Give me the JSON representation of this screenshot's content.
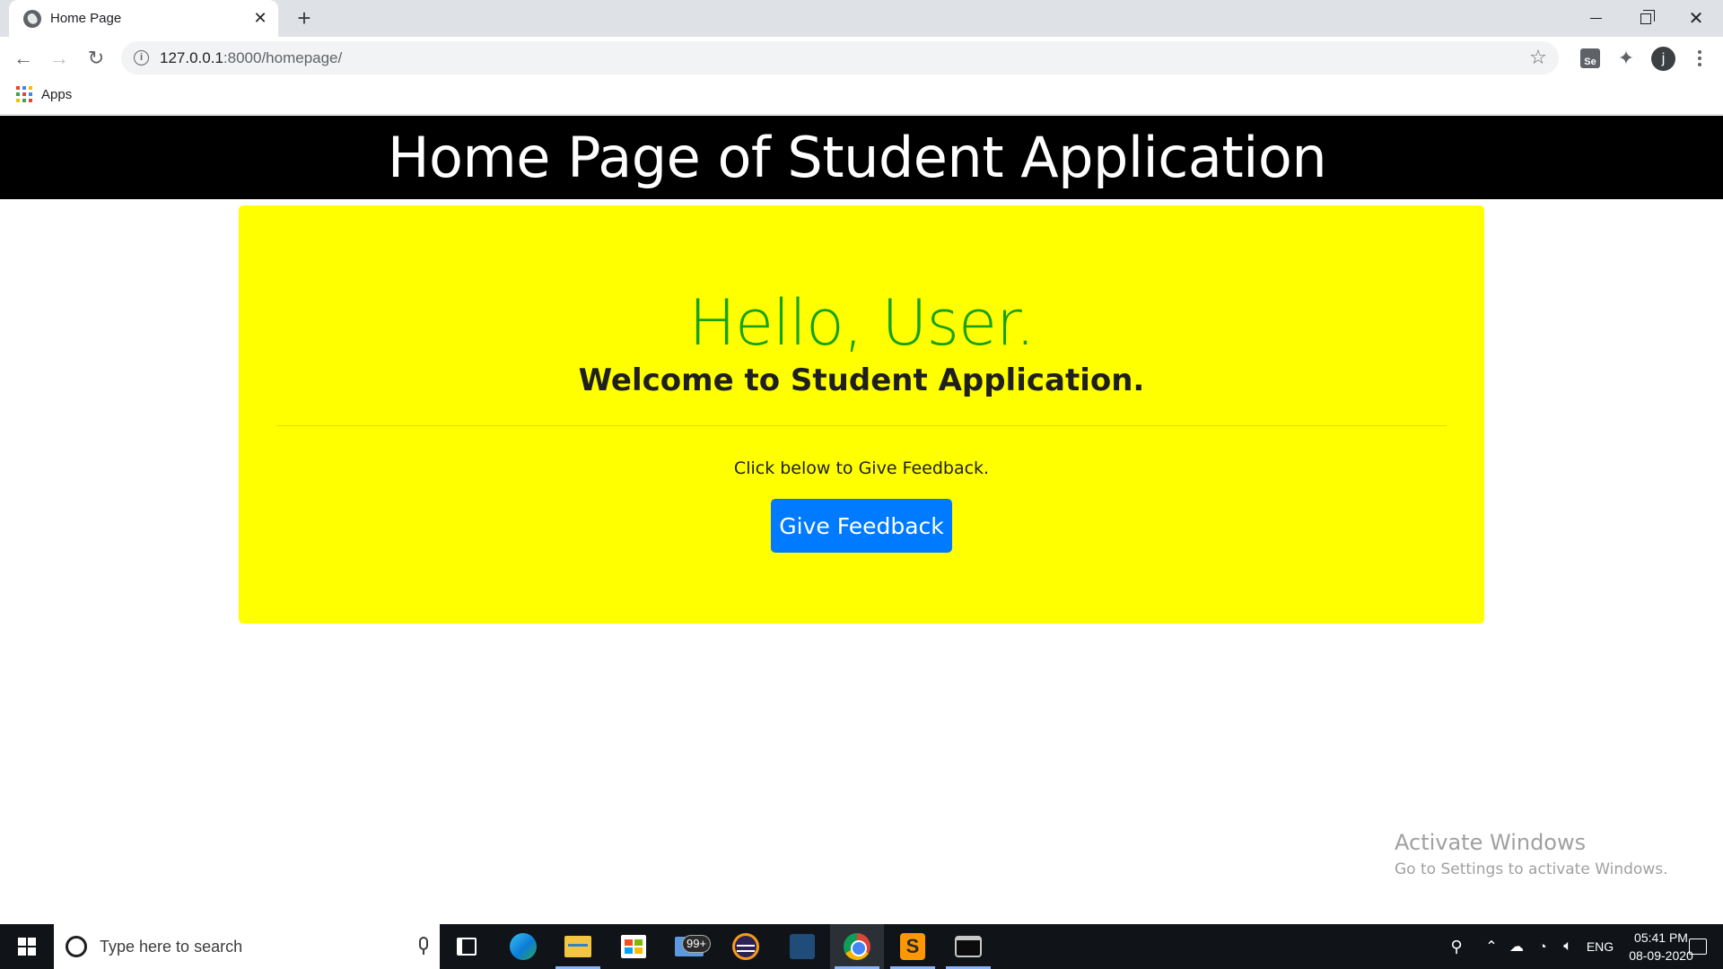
{
  "browser": {
    "tab_title": "Home Page",
    "url_host": "127.0.0.1",
    "url_path": ":8000/homepage/",
    "bookmarks": {
      "apps_label": "Apps"
    },
    "extensions": {
      "se_label": "Se"
    },
    "profile_initial": "j"
  },
  "page": {
    "header_title": "Home Page of Student Application",
    "greeting": "Hello, User.",
    "welcome": "Welcome to Student Application.",
    "hint": "Click below to Give Feedback.",
    "feedback_button": "Give Feedback",
    "colors": {
      "header_bg": "#000000",
      "jumbotron_bg": "#ffff00",
      "greeting": "#15a215",
      "button": "#007bff"
    }
  },
  "watermark": {
    "title": "Activate Windows",
    "subtitle": "Go to Settings to activate Windows."
  },
  "taskbar": {
    "search_placeholder": "Type here to search",
    "mail_badge": "99+",
    "language": "ENG",
    "time": "05:41 PM",
    "date": "08-09-2020",
    "apps": [
      "task-view",
      "edge",
      "file-explorer",
      "store",
      "mail",
      "eclipse",
      "mysql-workbench",
      "chrome",
      "sublime-text",
      "command-prompt"
    ]
  }
}
